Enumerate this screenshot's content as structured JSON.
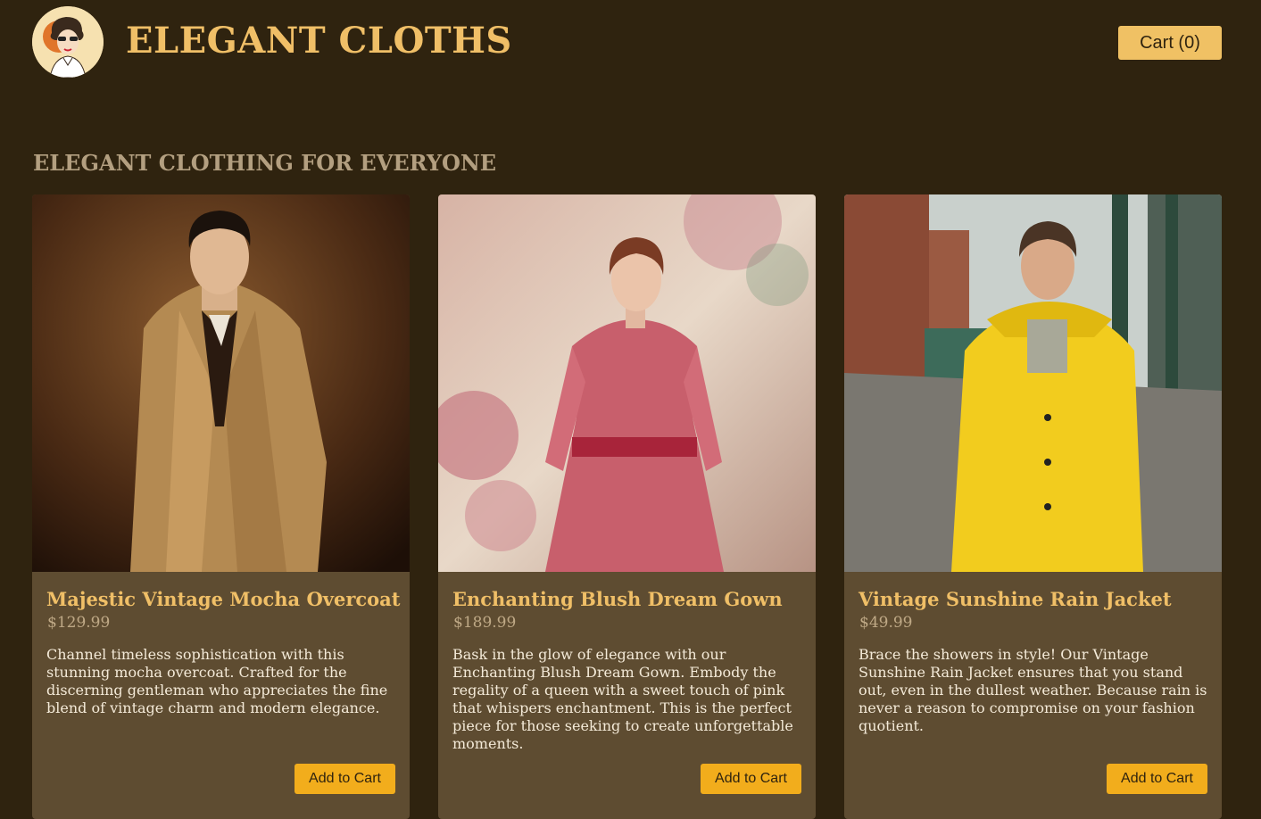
{
  "header": {
    "brand": "ELEGANT CLOTHS",
    "cart_label": "Cart (0)"
  },
  "main": {
    "section_title": "ELEGANT CLOTHING FOR EVERYONE",
    "products": [
      {
        "name": "Majestic Vintage Mocha Overcoat",
        "price": "$129.99",
        "description": "Channel timeless sophistication with this stunning mocha overcoat. Crafted for the discerning gentleman who appreciates the fine blend of vintage charm and modern elegance.",
        "button": "Add to Cart"
      },
      {
        "name": "Enchanting Blush Dream Gown",
        "price": "$189.99",
        "description": "Bask in the glow of elegance with our Enchanting Blush Dream Gown. Embody the regality of a queen with a sweet touch of pink that whispers enchantment. This is the perfect piece for those seeking to create unforgettable moments.",
        "button": "Add to Cart"
      },
      {
        "name": "Vintage Sunshine Rain Jacket",
        "price": "$49.99",
        "description": "Brace the showers in style! Our Vintage Sunshine Rain Jacket ensures that you stand out, even in the dullest weather. Because rain is never a reason to compromise on your fashion quotient.",
        "button": "Add to Cart"
      }
    ]
  },
  "colors": {
    "background": "#2f230f",
    "card": "#5e4c31",
    "accent": "#f0bf67",
    "button": "#f2ad1c"
  },
  "icons": {
    "logo": "vintage-lady-logo-icon"
  }
}
